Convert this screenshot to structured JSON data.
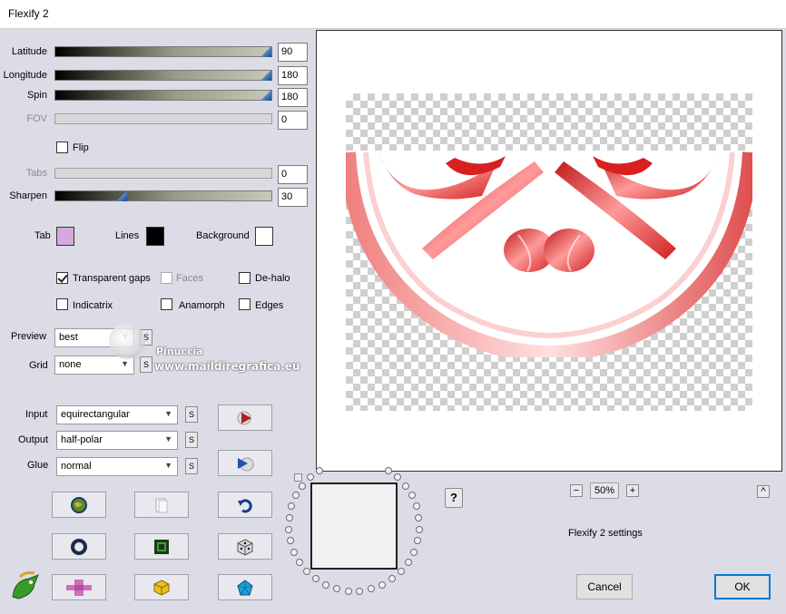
{
  "window": {
    "title": "Flexify 2"
  },
  "params": {
    "latitude": {
      "label": "Latitude",
      "value": "90",
      "level": 1.0
    },
    "longitude": {
      "label": "Longitude",
      "value": "180",
      "level": 1.0
    },
    "spin": {
      "label": "Spin",
      "value": "180",
      "level": 1.0
    },
    "fov": {
      "label": "FOV",
      "value": "0",
      "level": 0
    },
    "tabs": {
      "label": "Tabs",
      "value": "0",
      "level": 0
    },
    "sharpen": {
      "label": "Sharpen",
      "value": "30",
      "level": 0.3
    }
  },
  "flip": {
    "label": "Flip",
    "checked": false
  },
  "colors": {
    "tab": {
      "label": "Tab",
      "color": "#d7a8dc"
    },
    "lines": {
      "label": "Lines",
      "color": "#000000"
    },
    "background": {
      "label": "Background",
      "color": "#ffffff"
    }
  },
  "options": {
    "transparent_gaps": {
      "label": "Transparent gaps",
      "checked": true
    },
    "faces": {
      "label": "Faces",
      "checked": false,
      "disabled": true
    },
    "de_halo": {
      "label": "De-halo",
      "checked": false
    },
    "indicatrix": {
      "label": "Indicatrix",
      "checked": false
    },
    "anamorph": {
      "label": "Anamorph",
      "checked": false
    },
    "edges": {
      "label": "Edges",
      "checked": false
    }
  },
  "selects": {
    "preview": {
      "label": "Preview",
      "value": "best"
    },
    "grid": {
      "label": "Grid",
      "value": "none"
    },
    "input": {
      "label": "Input",
      "value": "equirectangular"
    },
    "output": {
      "label": "Output",
      "value": "half-polar"
    },
    "glue": {
      "label": "Glue",
      "value": "normal"
    }
  },
  "s_label": "S",
  "watermark": {
    "name": "Pinuccia",
    "url": "www.maildiregrafica.eu"
  },
  "zoom": {
    "value": "50%",
    "minus": "−",
    "plus": "+"
  },
  "settings_label": "Flexify 2 settings",
  "collapse_label": "^",
  "help_label": "?",
  "buttons": {
    "cancel": "Cancel",
    "ok": "OK"
  },
  "icons": [
    "globe-icon",
    "copy-icon",
    "undo-icon",
    "ring-icon",
    "square-frame-icon",
    "dice-icon",
    "cross-shape-icon",
    "cube-icon",
    "pentagon-icon",
    "flexify-logo-icon",
    "play-red-icon",
    "play-blue-icon"
  ],
  "accent": "#0078d7"
}
